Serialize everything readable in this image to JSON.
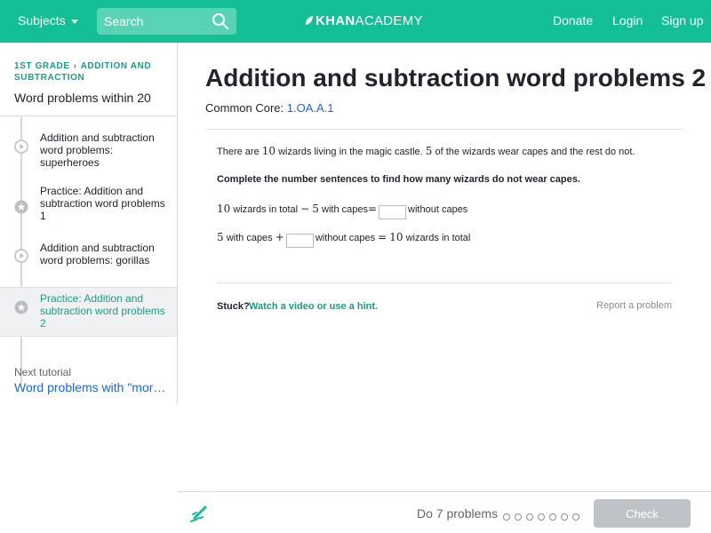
{
  "nav": {
    "subjects_label": "Subjects",
    "search_placeholder": "Search",
    "brand_left": "KHAN",
    "brand_right": "ACADEMY",
    "donate": "Donate",
    "login": "Login",
    "signup": "Sign up"
  },
  "sidebar": {
    "breadcrumb": [
      "1st grade",
      "Addition and subtraction"
    ],
    "title": "Word problems within 20",
    "items": [
      {
        "label": "Addition and subtraction word problems: superheroes",
        "kind": "video"
      },
      {
        "label": "Practice: Addition and subtraction word problems 1",
        "kind": "practice"
      },
      {
        "label": "Addition and subtraction word problems: gorillas",
        "kind": "video"
      },
      {
        "label": "Practice: Addition and subtraction word problems 2",
        "kind": "practice",
        "active": true
      }
    ],
    "next_label": "Next tutorial",
    "next_link": "Word problems with \"more\" and \"fewer\""
  },
  "main": {
    "title": "Addition and subtraction word problems 2",
    "cc_label": "Common Core:",
    "cc_code": "1.OA.A.1",
    "problem": {
      "intro_a": "There are",
      "n10": "10",
      "intro_b": "wizards living in the magic castle.",
      "n5": "5",
      "intro_c": "of the wizards wear capes and the rest do not.",
      "instruction": "Complete the number sentences to find how many wizards do not wear capes.",
      "s1_a": "wizards in total",
      "minus": "−",
      "s1_b": "with capes",
      "equals": "=",
      "s1_c": "without capes",
      "s2_a": "with capes",
      "plus": "+",
      "s2_b": "without capes",
      "s2_c": "wizards in total"
    },
    "stuck_label": "Stuck?",
    "stuck_link": "Watch a video or use a hint.",
    "report": "Report a problem"
  },
  "footer": {
    "do_label": "Do 7 problems",
    "problem_count": 7,
    "check_label": "Check"
  },
  "colors": {
    "brand": "#14bf96",
    "link": "#1865f2",
    "accent_text": "#1a9e82",
    "disabled_button": "#bfc3c7"
  }
}
